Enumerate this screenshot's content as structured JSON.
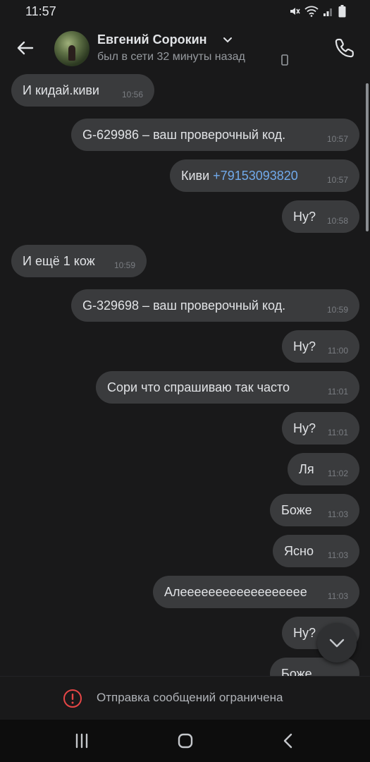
{
  "status_bar": {
    "time": "11:57",
    "icons": [
      "mute-icon",
      "wifi-icon",
      "signal-icon",
      "battery-icon"
    ]
  },
  "header": {
    "back_icon": "arrow-left-icon",
    "contact_name": "Евгений Сорокин",
    "contact_status": "был в сети 32 минуты назад",
    "status_device_icon": "phone-small-icon",
    "call_icon": "phone-call-icon"
  },
  "messages": [
    {
      "side": "in",
      "text": "И кидай.киви",
      "time": "10:56"
    },
    {
      "side": "out",
      "text": "G-629986 – ваш проверочный код.",
      "time": "10:57"
    },
    {
      "side": "out",
      "text_prefix": "Киви ",
      "link": "+79153093820",
      "time": "10:57"
    },
    {
      "side": "out",
      "text": "Ну?",
      "time": "10:58"
    },
    {
      "side": "in",
      "text": "И ещё 1 кож",
      "time": "10:59"
    },
    {
      "side": "out",
      "text": "G-329698 – ваш проверочный код.",
      "time": "10:59"
    },
    {
      "side": "out",
      "text": "Ну?",
      "time": "11:00"
    },
    {
      "side": "out",
      "text": "Сори что спрашиваю так часто",
      "time": "11:01"
    },
    {
      "side": "out",
      "text": "Ну?",
      "time": "11:01"
    },
    {
      "side": "out",
      "text": "Ля",
      "time": "11:02"
    },
    {
      "side": "out",
      "text": "Боже",
      "time": "11:03"
    },
    {
      "side": "out",
      "text": "Ясно",
      "time": "11:03"
    },
    {
      "side": "out",
      "text": "Алееееееееееееееееее",
      "time": "11:03"
    },
    {
      "side": "out",
      "text": "Ну?",
      "time": ""
    },
    {
      "side": "out",
      "text": "Боже",
      "time": ""
    }
  ],
  "restriction": {
    "icon": "alert-circle-icon",
    "text": "Отправка сообщений ограничена"
  },
  "scroll_down_icon": "chevron-down-icon",
  "nav_bar": {
    "recents_icon": "recents-icon",
    "home_icon": "home-icon",
    "back_icon": "nav-back-icon"
  },
  "colors": {
    "background": "#19191a",
    "bubble": "#3a3b3d",
    "link": "#71aaeb",
    "alert": "#e64646"
  }
}
